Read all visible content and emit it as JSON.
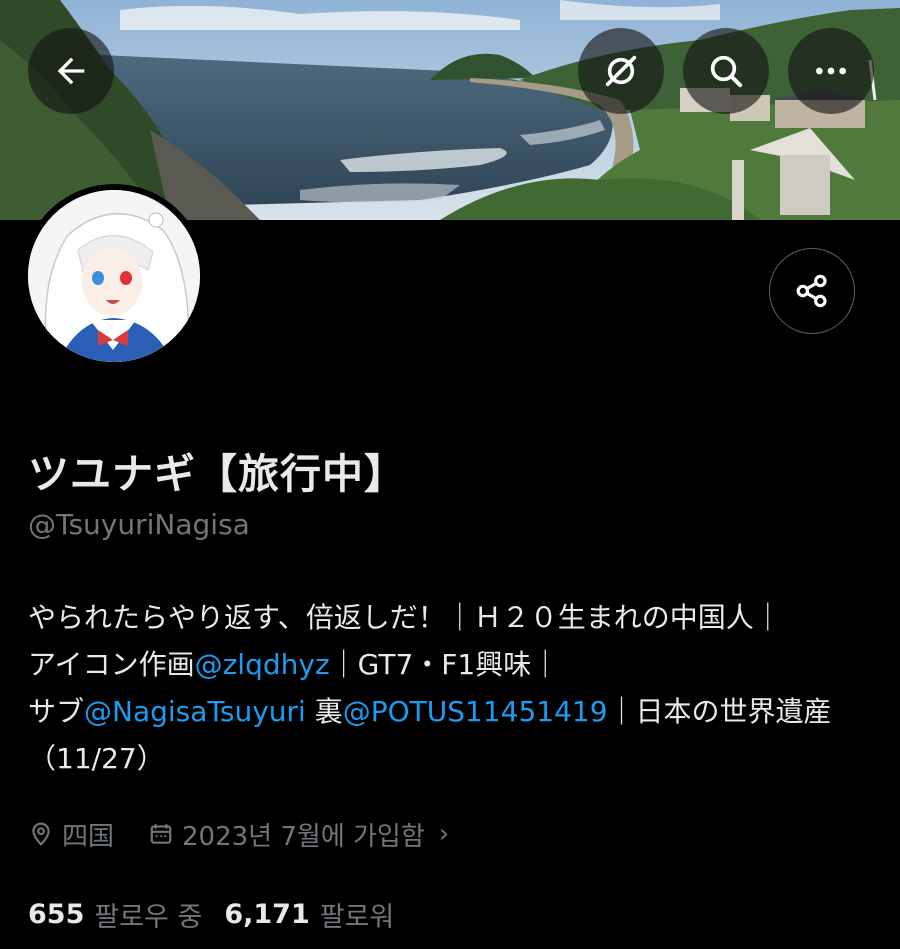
{
  "header": {
    "back_icon": "arrow-left-icon",
    "grok_icon": "grok-icon",
    "search_icon": "search-icon",
    "more_icon": "more-horizontal-icon"
  },
  "profile": {
    "display_name": "ツユナギ【旅行中】",
    "handle": "@TsuyuriNagisa",
    "share_icon": "share-icon"
  },
  "bio": {
    "line1": "やられたらやり返す、倍返しだ！｜Ｈ２０生まれの中国人｜",
    "line2_prefix": "アイコン作画",
    "line2_mention": "@zlqdhyz",
    "line2_suffix": "｜GT7・F1興味｜",
    "line3_prefix": "サブ",
    "line3_mention1": "@NagisaTsuyuri",
    "line3_mid": " 裏",
    "line3_mention2": "@POTUS11451419",
    "line3_suffix": "｜日本の世界遺産",
    "line4": "（11/27）"
  },
  "meta": {
    "location": "四国",
    "joined": "2023년 7월에 가입함",
    "location_icon": "location-pin-icon",
    "calendar_icon": "calendar-icon"
  },
  "stats": {
    "following_count": "655",
    "following_label": "팔로우 중",
    "followers_count": "6,171",
    "followers_label": "팔로워"
  },
  "colors": {
    "background": "#000000",
    "text_primary": "#e7e9ea",
    "text_secondary": "#71767b",
    "link": "#1d9bf0"
  }
}
